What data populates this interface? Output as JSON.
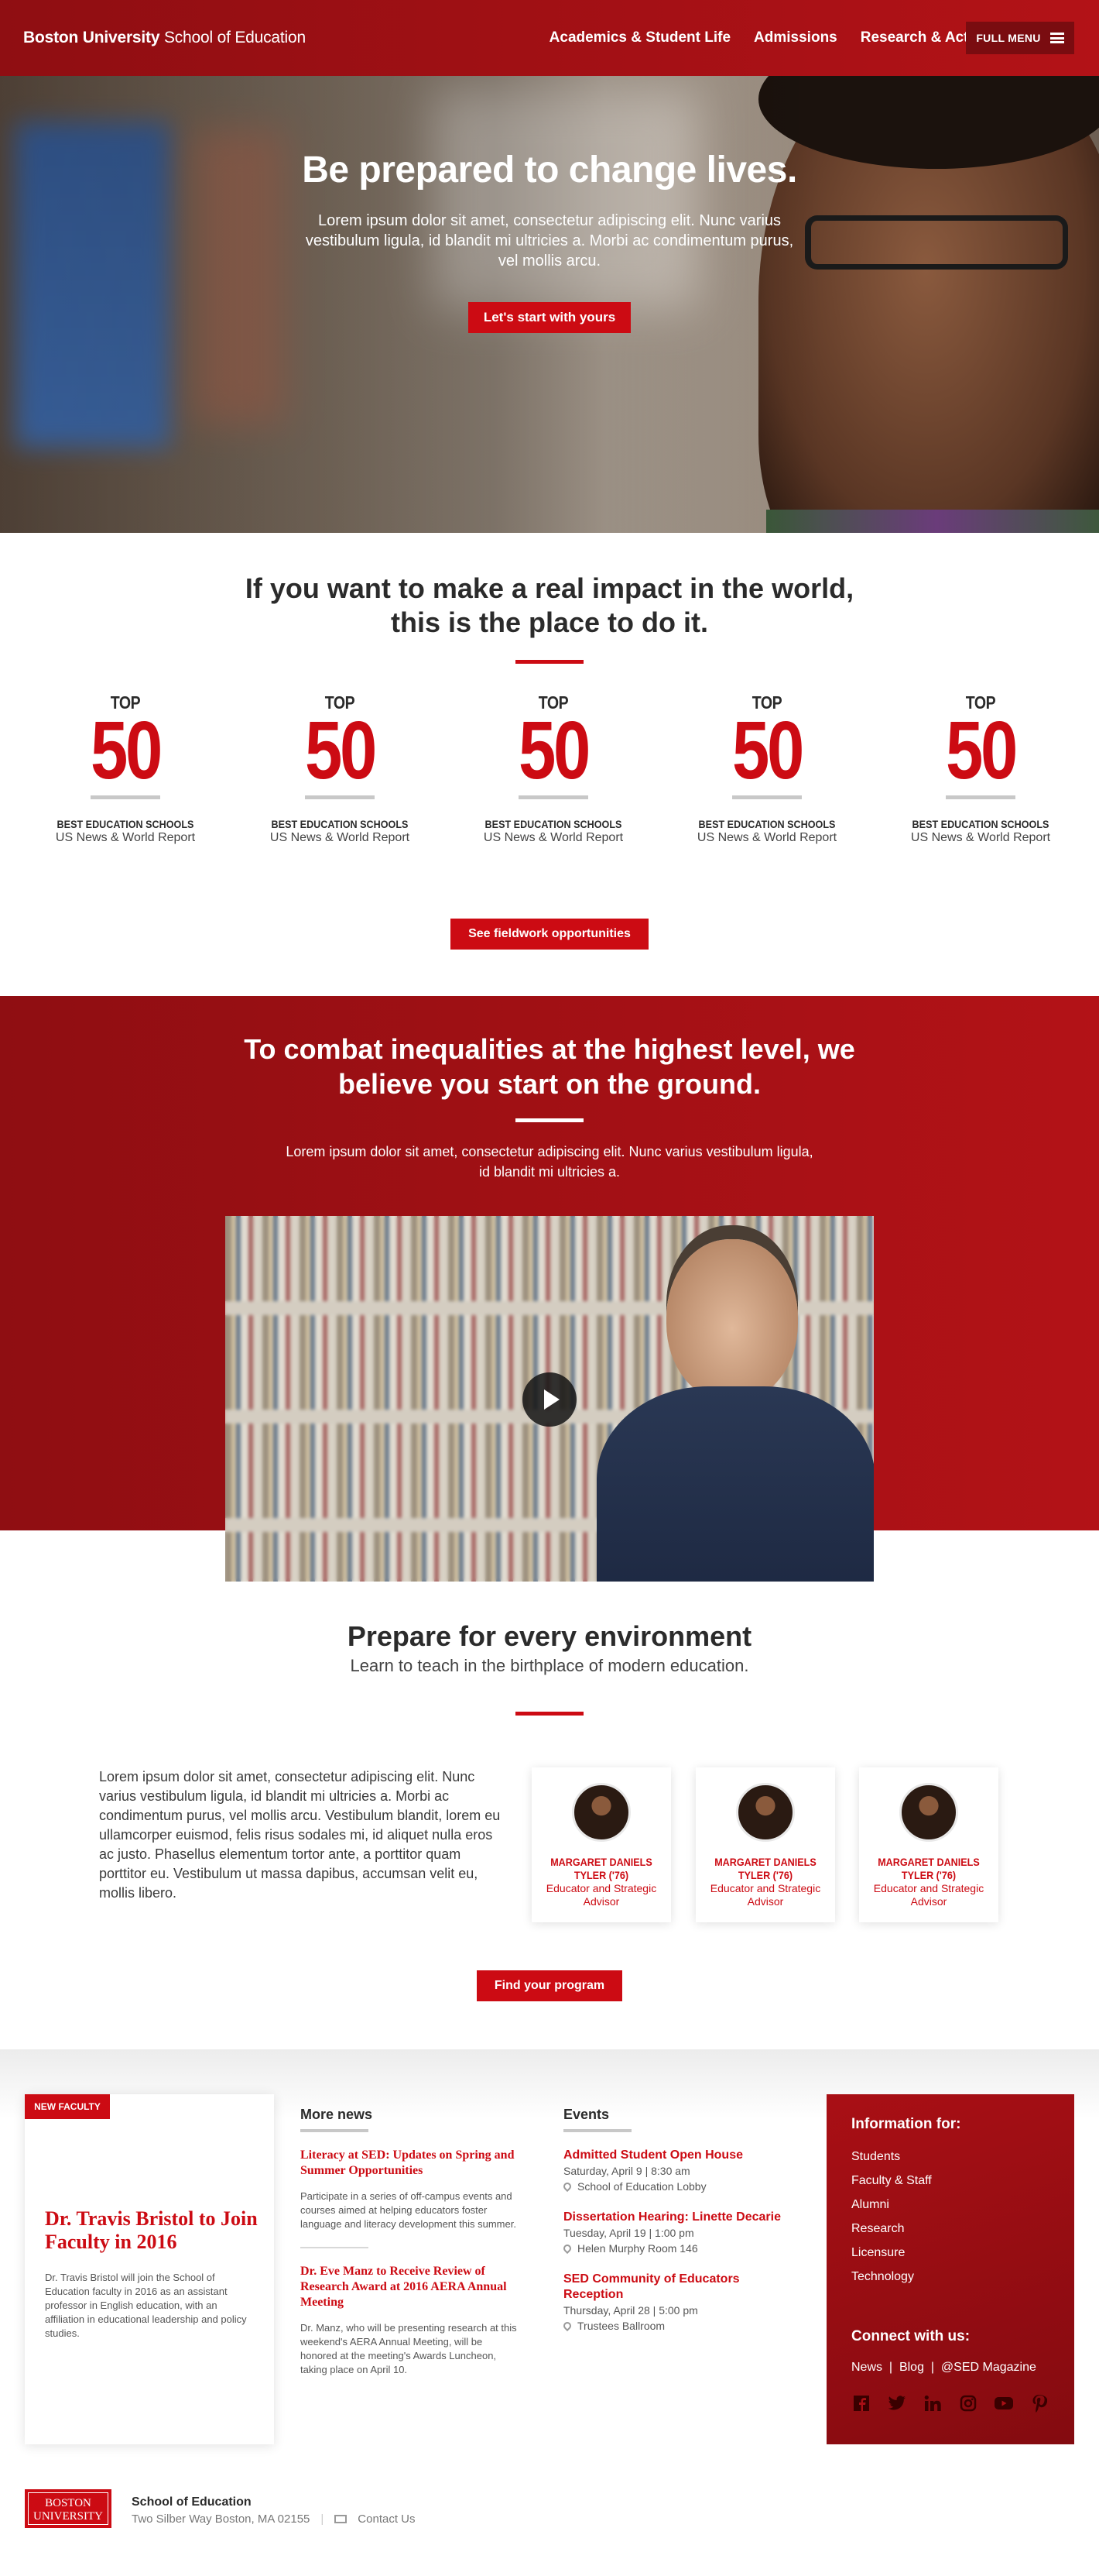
{
  "header": {
    "brand_bold": "Boston University",
    "brand_rest": "School of Education",
    "nav": [
      "Academics & Student Life",
      "Admissions",
      "Research & Action"
    ],
    "menu_label": "FULL MENU"
  },
  "hero": {
    "title": "Be prepared to change lives.",
    "text": "Lorem ipsum dolor sit amet, consectetur adipiscing elit. Nunc varius vestibulum ligula, id blandit mi ultricies a. Morbi ac condimentum purus, vel mollis arcu.",
    "cta": "Let's start with yours"
  },
  "impact": {
    "title": "If you want to make a real impact in the world, this is the place to do it.",
    "stats": [
      {
        "top": "TOP",
        "num": "50",
        "label": "BEST EDUCATION SCHOOLS",
        "src": "US News & World Report"
      },
      {
        "top": "TOP",
        "num": "50",
        "label": "BEST EDUCATION SCHOOLS",
        "src": "US News & World Report"
      },
      {
        "top": "TOP",
        "num": "50",
        "label": "BEST EDUCATION SCHOOLS",
        "src": "US News & World Report"
      },
      {
        "top": "TOP",
        "num": "50",
        "label": "BEST EDUCATION SCHOOLS",
        "src": "US News & World Report"
      },
      {
        "top": "TOP",
        "num": "50",
        "label": "BEST EDUCATION SCHOOLS",
        "src": "US News & World Report"
      }
    ],
    "cta": "See fieldwork opportunities"
  },
  "band": {
    "title": "To combat inequalities at the highest level, we believe you start on the ground.",
    "text": "Lorem ipsum dolor sit amet, consectetur adipiscing elit. Nunc varius vestibulum ligula, id blandit mi ultricies a."
  },
  "prepare": {
    "title": "Prepare for every environment",
    "subtitle": "Learn to teach in the birthplace of modern education.",
    "text": "Lorem ipsum dolor sit amet, consectetur adipiscing elit. Nunc varius vestibulum ligula, id blandit mi ultricies a. Morbi ac condimentum purus, vel mollis arcu. Vestibulum blandit, lorem eu ullamcorper euismod, felis risus sodales mi, id aliquet nulla eros ac justo. Phasellus elementum tortor ante, a porttitor quam porttitor eu. Vestibulum ut massa dapibus, accumsan velit eu, mollis libero.",
    "people": [
      {
        "name": "MARGARET DANIELS TYLER ('76)",
        "role": "Educator and Strategic Advisor"
      },
      {
        "name": "MARGARET DANIELS TYLER ('76)",
        "role": "Educator and Strategic Advisor"
      },
      {
        "name": "MARGARET DANIELS TYLER ('76)",
        "role": "Educator and Strategic Advisor"
      }
    ],
    "cta": "Find your program"
  },
  "featured": {
    "badge": "NEW FACULTY",
    "title": "Dr. Travis Bristol to Join Faculty in 2016",
    "text": "Dr. Travis Bristol will join the School of Education faculty in 2016 as an assistant professor in English education, with an affiliation in educational leadership and policy studies."
  },
  "news": {
    "heading": "More news",
    "items": [
      {
        "title": "Literacy at SED: Updates on Spring and Summer Opportunities",
        "text": "Participate in a series of off-campus events and courses aimed at helping educators foster language and literacy development this summer."
      },
      {
        "title": "Dr. Eve Manz to Receive Review of Research Award at 2016 AERA Annual Meeting",
        "text": "Dr. Manz, who will be presenting research at this weekend's AERA Annual Meeting, will be honored at the meeting's Awards Luncheon, taking place on April 10."
      }
    ]
  },
  "events": {
    "heading": "Events",
    "items": [
      {
        "title": "Admitted Student Open House",
        "time": "Saturday, April 9 | 8:30 am",
        "location": "School of Education Lobby"
      },
      {
        "title": "Dissertation Hearing: Linette Decarie",
        "time": "Tuesday, April 19 | 1:00 pm",
        "location": "Helen Murphy Room 146"
      },
      {
        "title": "SED Community of Educators Reception",
        "time": "Thursday, April 28 | 5:00 pm",
        "location": "Trustees Ballroom"
      }
    ]
  },
  "info": {
    "heading": "Information for:",
    "items": [
      "Students",
      "Faculty & Staff",
      "Alumni",
      "Research",
      "Licensure",
      "Technology"
    ],
    "connect_heading": "Connect with us:",
    "links": [
      "News",
      "Blog",
      "@SED Magazine"
    ],
    "social": [
      "facebook-icon",
      "twitter-icon",
      "linkedin-icon",
      "instagram-icon",
      "youtube-icon",
      "pinterest-icon"
    ]
  },
  "footer": {
    "logo_line1": "BOSTON",
    "logo_line2": "UNIVERSITY",
    "name": "School of Education",
    "address": "Two Silber Way Boston, MA 02155",
    "contact": "Contact Us"
  },
  "colors": {
    "accent": "#cc0b13",
    "band": "#a50f14"
  }
}
